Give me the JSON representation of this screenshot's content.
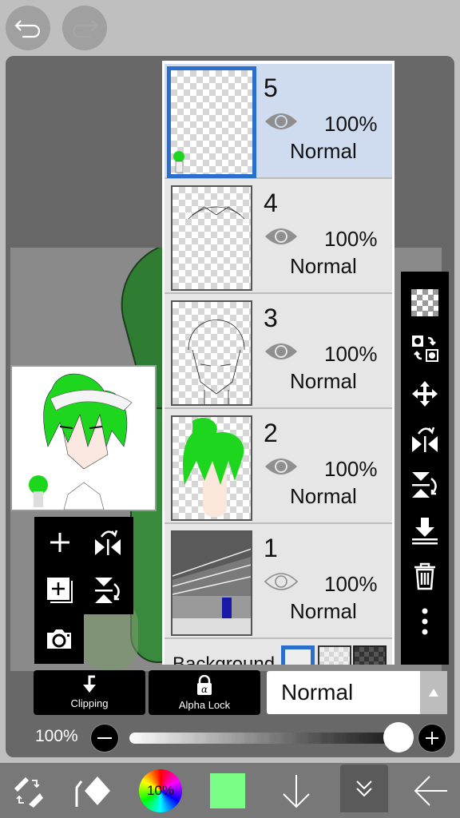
{
  "top": {
    "undo_icon": "undo-icon",
    "redo_icon": "redo-icon"
  },
  "layers": [
    {
      "number": "5",
      "opacity": "100%",
      "blend_mode": "Normal",
      "visible": true,
      "selected": true,
      "thumbnail": "small chibi figure bottom-left"
    },
    {
      "number": "4",
      "opacity": "100%",
      "blend_mode": "Normal",
      "visible": true,
      "selected": false,
      "thumbnail": "braid lineart"
    },
    {
      "number": "3",
      "opacity": "100%",
      "blend_mode": "Normal",
      "visible": true,
      "selected": false,
      "thumbnail": "head lineart"
    },
    {
      "number": "2",
      "opacity": "100%",
      "blend_mode": "Normal",
      "visible": true,
      "selected": false,
      "thumbnail": "green hair and skin color"
    },
    {
      "number": "1",
      "opacity": "100%",
      "blend_mode": "Normal",
      "visible": false,
      "selected": false,
      "thumbnail": "grayscale room photo"
    }
  ],
  "background": {
    "label": "Background",
    "options": [
      "white",
      "transparent",
      "dark"
    ],
    "selected": "white"
  },
  "right_toolbar": [
    "transparency-checker-icon",
    "swap-layer-icon",
    "move-icon",
    "flip-horizontal-icon",
    "flip-vertical-icon",
    "merge-down-icon",
    "trash-icon",
    "more-icon"
  ],
  "left_tools": [
    "add-layer-icon",
    "flip-horizontal-icon",
    "duplicate-layer-icon",
    "flip-vertical-icon",
    "camera-icon"
  ],
  "controls": {
    "clipping_label": "Clipping",
    "alpha_lock_label": "Alpha Lock",
    "alpha_lock_glyph": "α",
    "blend_mode": "Normal",
    "opacity_label": "100%",
    "opacity_value": 1.0,
    "minus": "−",
    "plus": "+"
  },
  "bottom_bar": {
    "brush_size_label": "10%",
    "current_color": "#7aff86"
  }
}
